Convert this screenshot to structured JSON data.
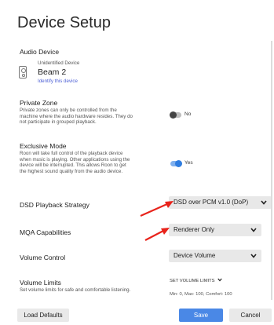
{
  "page": {
    "title": "Device Setup"
  },
  "audio_device": {
    "label": "Audio Device",
    "subtitle": "Unidentified Device",
    "name": "Beam 2",
    "identify_link": "Identify this device",
    "icon": "speaker-icon"
  },
  "private_zone": {
    "label": "Private Zone",
    "description_lines": [
      "Private zones can only be controlled from the",
      "machine where the audio hardware resides. They do",
      "not participate in grouped playback."
    ],
    "toggle_label": "No",
    "enabled": false
  },
  "exclusive_mode": {
    "label": "Exclusive Mode",
    "description_lines": [
      "Roon will take full control of the playback device",
      "when music is playing. Other applications using the",
      "device will be interrupted. This allows Roon to get",
      "the highest sound quality from the audio device."
    ],
    "toggle_label": "Yes",
    "enabled": true
  },
  "dsd_playback": {
    "label": "DSD Playback Strategy",
    "value": "DSD over PCM v1.0 (DoP)"
  },
  "mqa": {
    "label": "MQA Capabilities",
    "value": "Renderer Only"
  },
  "volume_control": {
    "label": "Volume Control",
    "value": "Device Volume"
  },
  "volume_limits": {
    "label": "Volume Limits",
    "description": "Set volume limits for safe and comfortable listening.",
    "link": "SET VOLUME LIMITS",
    "summary": "Min: 0, Max: 100, Comfort: 100"
  },
  "footer": {
    "load_defaults": "Load Defaults",
    "save": "Save",
    "cancel": "Cancel"
  },
  "colors": {
    "accent": "#4a88e6",
    "toggle_on": "#2f7de0",
    "annotation_arrow": "#e8231b"
  }
}
